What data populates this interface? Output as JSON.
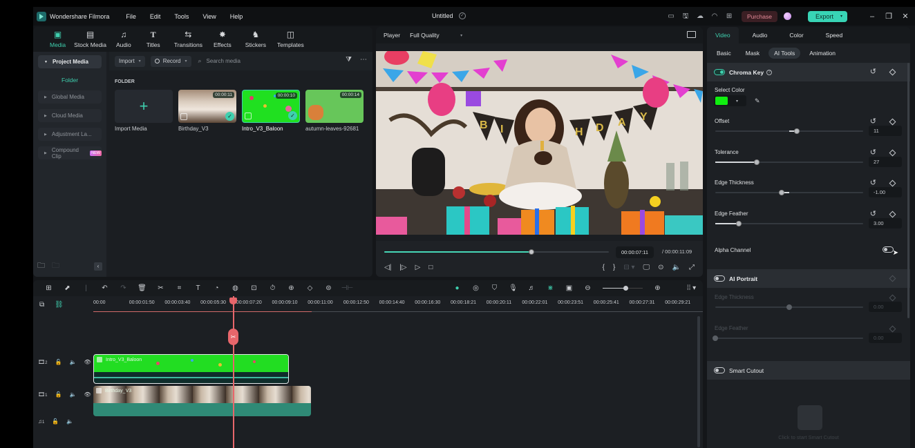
{
  "titlebar": {
    "app_name": "Wondershare Filmora",
    "menu": [
      "File",
      "Edit",
      "Tools",
      "View",
      "Help"
    ],
    "doc_title": "Untitled",
    "purchase_label": "Purchase",
    "export_label": "Export",
    "icons": [
      "layout-icon",
      "save-icon",
      "cloud-upload-icon",
      "support-headset-icon",
      "apps-grid-icon"
    ]
  },
  "media_tabs": [
    {
      "label": "Media",
      "icon": "media-icon",
      "active": true
    },
    {
      "label": "Stock Media",
      "icon": "stock-media-icon"
    },
    {
      "label": "Audio",
      "icon": "music-note-icon"
    },
    {
      "label": "Titles",
      "icon": "text-t-icon"
    },
    {
      "label": "Transitions",
      "icon": "transitions-icon"
    },
    {
      "label": "Effects",
      "icon": "effects-sparkle-icon"
    },
    {
      "label": "Stickers",
      "icon": "stickers-icon"
    },
    {
      "label": "Templates",
      "icon": "templates-icon"
    }
  ],
  "sidebar": {
    "project_media": "Project Media",
    "folder": "Folder",
    "items": [
      "Global Media",
      "Cloud Media",
      "Adjustment La...",
      "Compound Clip"
    ],
    "new_badge": "NEW"
  },
  "media_toolbar": {
    "import_label": "Import",
    "record_label": "Record",
    "search_placeholder": "Search media"
  },
  "folder": {
    "title": "FOLDER",
    "items": [
      {
        "name": "Import Media",
        "type": "import"
      },
      {
        "name": "Birthday_V3",
        "duration": "00:00:11",
        "used": true
      },
      {
        "name": "Intro_V3_Baloon",
        "duration": "00:00:10",
        "used": true,
        "selected": true
      },
      {
        "name": "autumn-leaves-92681",
        "duration": "00:00:14"
      }
    ]
  },
  "player": {
    "label": "Player",
    "quality": "Full Quality",
    "current_time": "00:00:07:11",
    "total_time": "/ 00:00:11:09",
    "progress": 0.655
  },
  "properties": {
    "tabs": [
      "Video",
      "Audio",
      "Color",
      "Speed"
    ],
    "active_tab": "Video",
    "subtabs": [
      "Basic",
      "Mask",
      "AI Tools",
      "Animation"
    ],
    "active_subtab": "AI Tools",
    "chroma_key": {
      "title": "Chroma Key",
      "enabled": true,
      "select_color_label": "Select Color",
      "color": "#10EE10",
      "params": [
        {
          "label": "Offset",
          "value": "11",
          "fraction": 0.55
        },
        {
          "label": "Tolerance",
          "value": "27",
          "fraction": 0.28
        },
        {
          "label": "Edge Thickness",
          "value": "-1.00",
          "fraction": 0.45
        },
        {
          "label": "Edge Feather",
          "value": "3.00",
          "fraction": 0.16
        }
      ],
      "alpha_channel_label": "Alpha Channel",
      "alpha_channel": false
    },
    "ai_portrait": {
      "title": "AI Portrait",
      "enabled": false,
      "params": [
        {
          "label": "Edge Thickness",
          "value": "0.00",
          "fraction": 0.5
        },
        {
          "label": "Edge Feather",
          "value": "0.00",
          "fraction": 0.0
        }
      ]
    },
    "smart_cutout": {
      "title": "Smart Cutout",
      "enabled": false,
      "hint": "Click to start Smart Cutout"
    }
  },
  "timeline": {
    "ruler": [
      "00:00",
      "00:00:01:50",
      "00:00:03:40",
      "00:00:05:30",
      "00:00:07:20",
      "00:00:09:10",
      "00:00:11:00",
      "00:00:12:50",
      "00:00:14:40",
      "00:00:16:30",
      "00:00:18:21",
      "00:00:20:11",
      "00:00:22:01",
      "00:00:23:51",
      "00:00:25:41",
      "00:00:27:31",
      "00:00:29:21"
    ],
    "tracks": [
      {
        "type": "video",
        "index": "2"
      },
      {
        "type": "video",
        "index": "1"
      },
      {
        "type": "audio",
        "index": "1"
      }
    ],
    "clips": [
      {
        "track": "video-2",
        "name": "Intro_V3_Baloon"
      },
      {
        "track": "video-1",
        "name": "Birthday_V3"
      }
    ],
    "zoom_level": 0.52
  }
}
